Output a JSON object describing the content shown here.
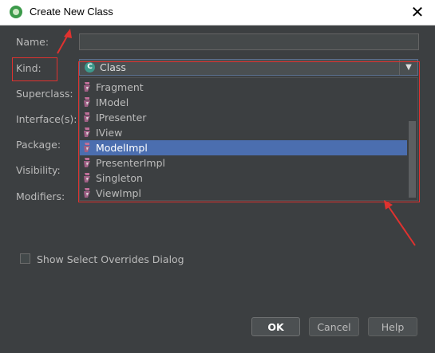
{
  "window": {
    "title": "Create New Class",
    "close_icon": "close-icon"
  },
  "form": {
    "name_label": "Name:",
    "name_value": "",
    "kind_label": "Kind:",
    "kind_value": "Class",
    "superclass_label": "Superclass:",
    "interfaces_label": "Interface(s):",
    "package_label": "Package:",
    "visibility_label": "Visibility:",
    "modifiers_label": "Modifiers:"
  },
  "dropdown": {
    "items": [
      {
        "label": "Fragment",
        "selected": false
      },
      {
        "label": "IModel",
        "selected": false
      },
      {
        "label": "IPresenter",
        "selected": false
      },
      {
        "label": "IView",
        "selected": false
      },
      {
        "label": "ModelImpl",
        "selected": true
      },
      {
        "label": "PresenterImpl",
        "selected": false
      },
      {
        "label": "Singleton",
        "selected": false
      },
      {
        "label": "ViewImpl",
        "selected": false
      }
    ]
  },
  "options": {
    "show_overrides_label": "Show Select Overrides Dialog",
    "show_overrides_checked": false
  },
  "buttons": {
    "ok": "OK",
    "cancel": "Cancel",
    "help": "Help"
  },
  "colors": {
    "annotation": "#e0322f",
    "selection": "#4b6eaf",
    "background": "#3c3f41"
  }
}
